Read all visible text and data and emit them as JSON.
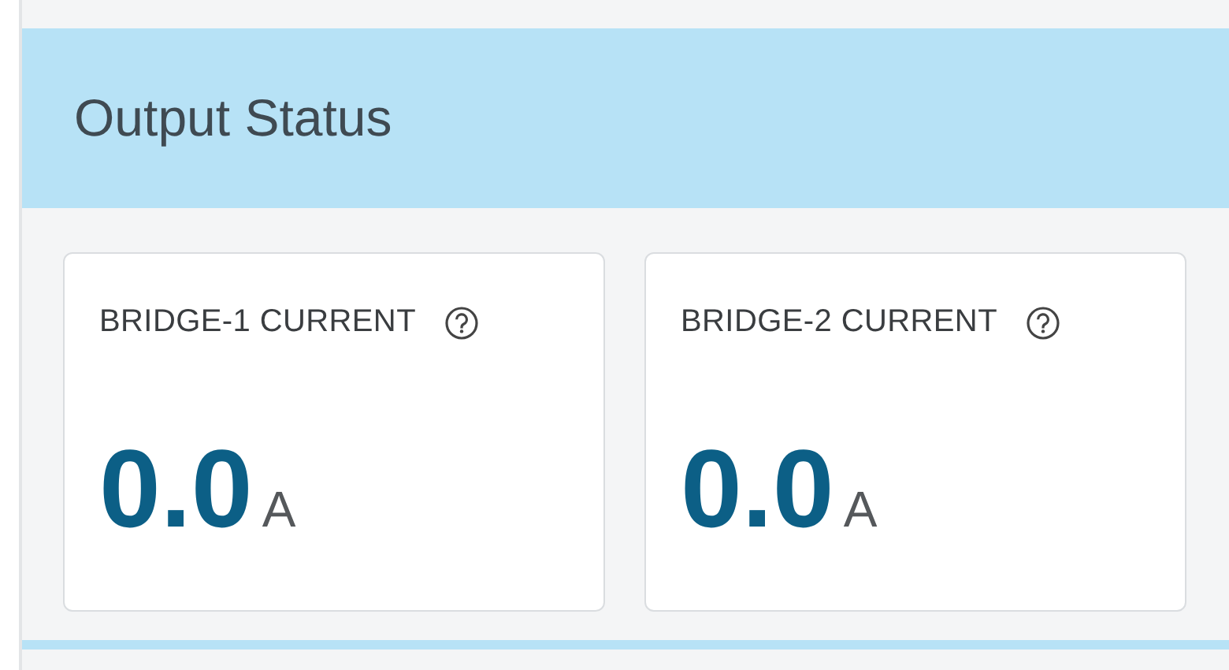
{
  "panel": {
    "title": "Output Status"
  },
  "cards": [
    {
      "label": "BRIDGE-1 CURRENT",
      "value": "0.0",
      "unit": "A"
    },
    {
      "label": "BRIDGE-2 CURRENT",
      "value": "0.0",
      "unit": "A"
    }
  ]
}
